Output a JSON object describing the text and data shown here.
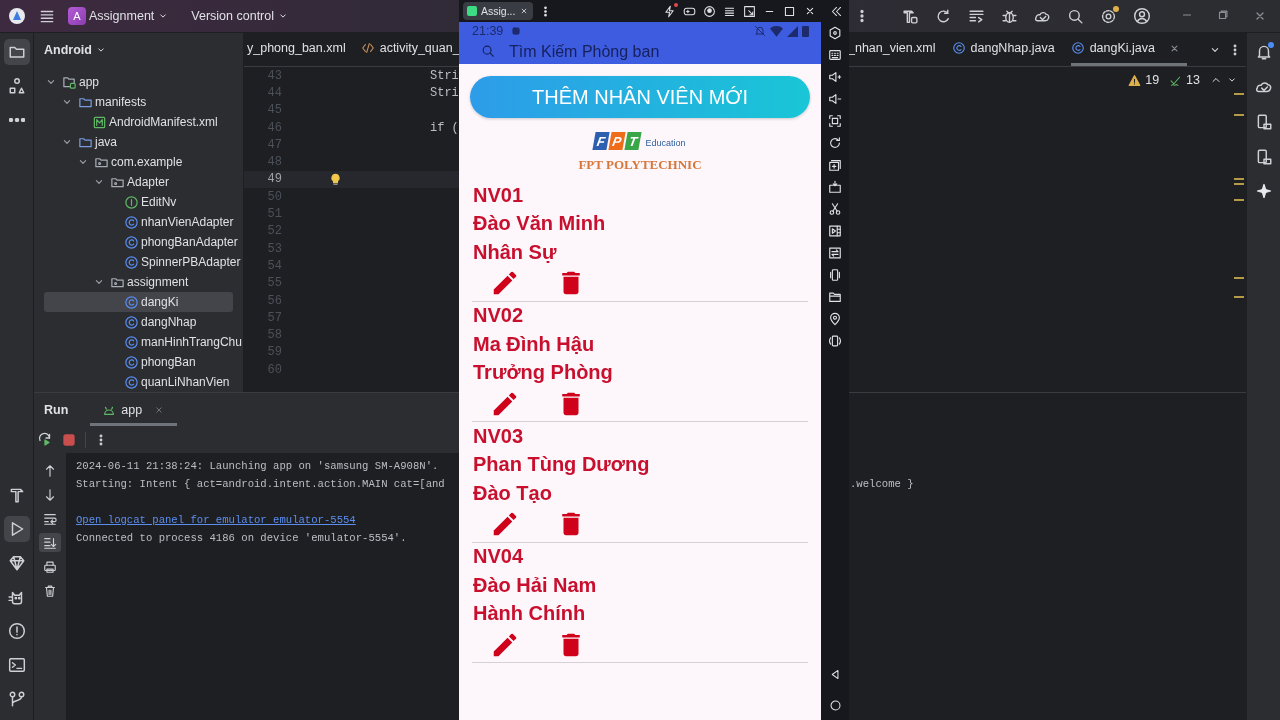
{
  "ide": {
    "title_bar": {
      "project_initial": "A",
      "project": "Assignment",
      "vcs": "Version control"
    },
    "left_toolbar": [
      {
        "kind": "folder",
        "selected": true
      },
      {
        "kind": "structure",
        "selected": false
      },
      {
        "kind": "more",
        "selected": false
      }
    ],
    "left_toolbar_bottom": [
      {
        "kind": "build",
        "selected": false
      },
      {
        "kind": "run",
        "selected": true
      },
      {
        "kind": "gem",
        "selected": false
      },
      {
        "kind": "cat",
        "selected": false
      },
      {
        "kind": "problems",
        "selected": false
      },
      {
        "kind": "terminal",
        "selected": false
      },
      {
        "kind": "git",
        "selected": false
      }
    ],
    "project_panel": {
      "view": "Android",
      "tree": [
        {
          "label": "app",
          "kind": "module",
          "expanded": true,
          "selected": false,
          "children": [
            {
              "label": "manifests",
              "kind": "folder",
              "expanded": true,
              "selected": false,
              "children": [
                {
                  "label": "AndroidManifest.xml",
                  "kind": "manifest",
                  "selected": false
                }
              ]
            },
            {
              "label": "java",
              "kind": "folder",
              "expanded": true,
              "selected": false,
              "children": [
                {
                  "label": "com.example",
                  "kind": "package",
                  "expanded": true,
                  "selected": false,
                  "children": [
                    {
                      "label": "Adapter",
                      "kind": "package",
                      "expanded": true,
                      "selected": false,
                      "children": [
                        {
                          "label": "EditNv",
                          "kind": "interface",
                          "selected": false
                        },
                        {
                          "label": "nhanVienAdapter",
                          "kind": "class",
                          "selected": false
                        },
                        {
                          "label": "phongBanAdapter",
                          "kind": "class",
                          "selected": false
                        },
                        {
                          "label": "SpinnerPBAdapter",
                          "kind": "class",
                          "selected": false
                        }
                      ]
                    },
                    {
                      "label": "assignment",
                      "kind": "package",
                      "expanded": true,
                      "selected": false,
                      "children": [
                        {
                          "label": "dangKi",
                          "kind": "class",
                          "selected": true
                        },
                        {
                          "label": "dangNhap",
                          "kind": "class",
                          "selected": false
                        },
                        {
                          "label": "manHinhTrangChu",
                          "kind": "class",
                          "selected": false
                        },
                        {
                          "label": "phongBan",
                          "kind": "class",
                          "selected": false
                        },
                        {
                          "label": "quanLiNhanVien",
                          "kind": "class",
                          "selected": false
                        }
                      ]
                    }
                  ]
                }
              ]
            }
          ]
        }
      ]
    },
    "editor": {
      "tabs_left": [
        {
          "label": "y_phong_ban.xml",
          "kind": "xml",
          "selected": false
        },
        {
          "label": "activity_quan_",
          "kind": "code",
          "selected": false
        }
      ],
      "tabs_right": [
        {
          "label": "_nhan_vien.xml",
          "kind": "xml",
          "selected": false
        },
        {
          "label": "dangNhap.java",
          "kind": "class",
          "selected": false
        },
        {
          "label": "dangKi.java",
          "kind": "class",
          "selected": true
        }
      ],
      "warnings": "19",
      "weak_warnings": "13",
      "lines": [
        {
          "number": "43",
          "code": "Stri",
          "current": false
        },
        {
          "number": "44",
          "code": "Stri",
          "current": false
        },
        {
          "number": "45",
          "current": false
        },
        {
          "number": "46",
          "code": "if (",
          "current": false
        },
        {
          "number": "47",
          "current": false
        },
        {
          "number": "48",
          "current": false
        },
        {
          "number": "49",
          "current": true
        },
        {
          "number": "50",
          "current": false
        },
        {
          "number": "51",
          "current": false
        },
        {
          "number": "52",
          "current": false
        },
        {
          "number": "53",
          "current": false
        },
        {
          "number": "54",
          "current": false
        },
        {
          "number": "55",
          "current": false
        },
        {
          "number": "56",
          "current": false
        },
        {
          "number": "57",
          "current": false
        },
        {
          "number": "58",
          "current": false
        },
        {
          "number": "59",
          "current": false
        },
        {
          "number": "60",
          "current": false
        }
      ]
    },
    "run_panel": {
      "title": "Run",
      "tabs": [
        {
          "label": "app",
          "selected": true
        }
      ],
      "tools": [
        {
          "kind": "up",
          "selected": false
        },
        {
          "kind": "down",
          "selected": false
        },
        {
          "kind": "wrap",
          "selected": false
        },
        {
          "kind": "scroll-end",
          "selected": true
        },
        {
          "kind": "print",
          "selected": false
        },
        {
          "kind": "trash",
          "selected": false
        }
      ],
      "console": [
        {
          "kind": "plain",
          "text": "2024-06-11 21:38:24: Launching app on 'samsung SM-A908N'."
        },
        {
          "kind": "plain",
          "text": "Starting: Intent { act=android.intent.action.MAIN cat=[and",
          "tail": ".welcome }"
        },
        {
          "kind": "link",
          "text": "Open logcat panel for emulator emulator-5554"
        },
        {
          "kind": "plain",
          "text": "Connected to process 4186 on device 'emulator-5554'."
        }
      ]
    }
  },
  "emulator": {
    "tab": {
      "label": "Assig...",
      "selected": true
    },
    "status_bar": {
      "time": "21:39"
    },
    "search": {
      "placeholder": "Tìm Kiếm Phòng ban"
    },
    "add_button": "THÊM NHÂN VIÊN MỚI",
    "logo": {
      "letters": [
        "F",
        "P",
        "T"
      ],
      "tagline": "Education",
      "name": "FPT POLYTECHNIC"
    },
    "employees": [
      {
        "id": "NV01",
        "name": "Đào Văn Minh",
        "department": "Nhân Sự"
      },
      {
        "id": "NV02",
        "name": "Ma Đình Hậu",
        "department": "Trưởng Phòng"
      },
      {
        "id": "NV03",
        "name": "Phan Tùng Dương",
        "department": "Đào Tạo"
      },
      {
        "id": "NV04",
        "name": "Đào Hải Nam",
        "department": "Hành Chính"
      }
    ]
  }
}
